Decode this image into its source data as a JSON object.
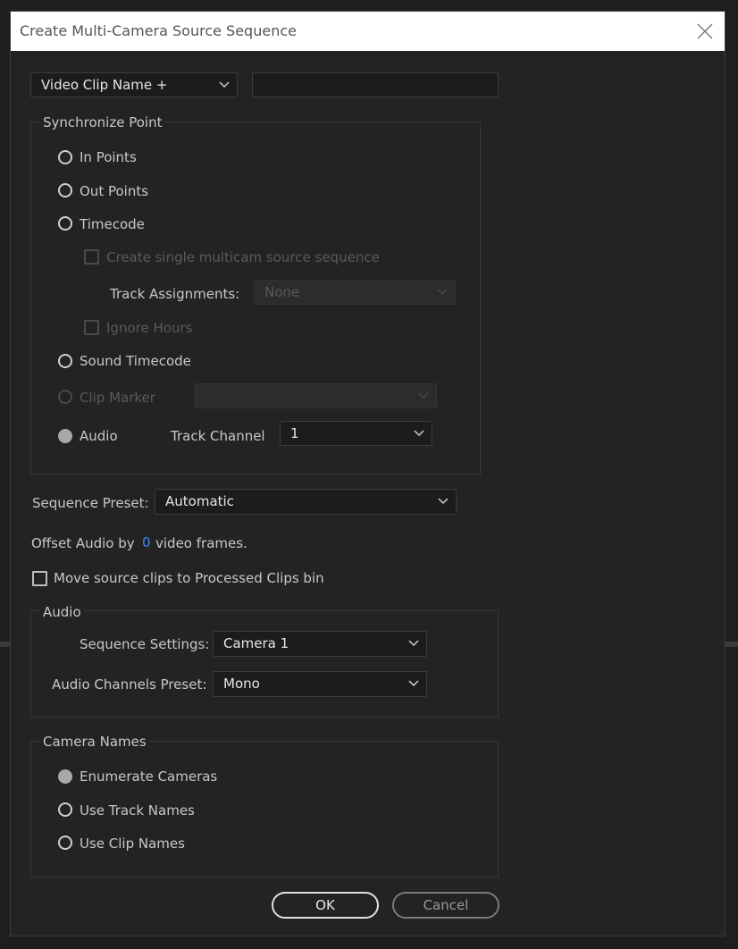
{
  "dialog": {
    "title": "Create Multi-Camera Source Sequence",
    "name_dropdown": "Video Clip Name +",
    "name_input": ""
  },
  "sync": {
    "legend": "Synchronize Point",
    "in_points": "In Points",
    "out_points": "Out Points",
    "timecode": "Timecode",
    "single_multicam": "Create single multicam source sequence",
    "track_assignments_label": "Track Assignments:",
    "track_assignments_value": "None",
    "ignore_hours": "Ignore Hours",
    "sound_timecode": "Sound Timecode",
    "clip_marker": "Clip Marker",
    "clip_marker_value": "",
    "audio": "Audio",
    "track_channel_label": "Track Channel",
    "track_channel_value": "1"
  },
  "sequence_preset": {
    "label": "Sequence Preset:",
    "value": "Automatic"
  },
  "offset": {
    "prefix": "Offset Audio by",
    "value": "0",
    "suffix": "video frames."
  },
  "move_clips": "Move source clips to Processed Clips bin",
  "audio_group": {
    "legend": "Audio",
    "seq_settings_label": "Sequence Settings:",
    "seq_settings_value": "Camera 1",
    "channels_label": "Audio Channels Preset:",
    "channels_value": "Mono"
  },
  "camera_names": {
    "legend": "Camera Names",
    "enumerate": "Enumerate Cameras",
    "track_names": "Use Track Names",
    "clip_names": "Use Clip Names"
  },
  "buttons": {
    "ok": "OK",
    "cancel": "Cancel"
  },
  "icons": {
    "close": "close-icon",
    "chevron": "chevron-down-icon"
  }
}
